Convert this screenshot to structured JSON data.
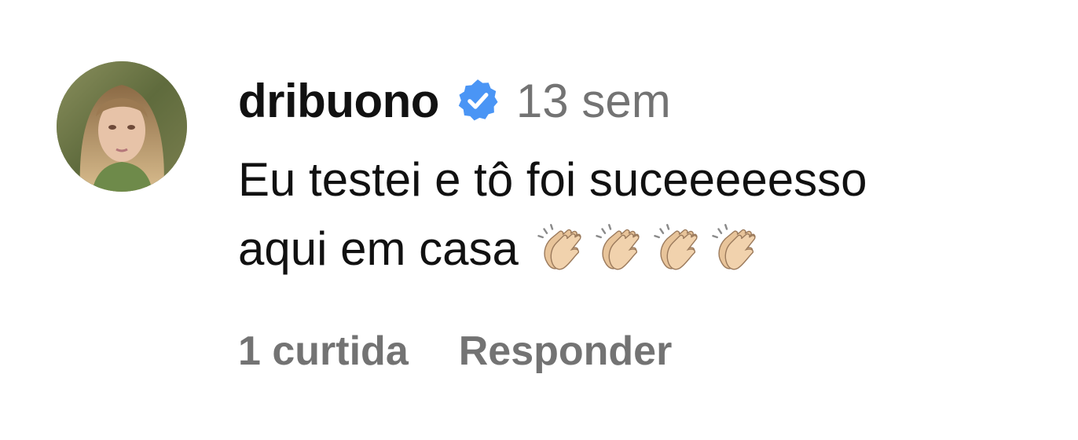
{
  "comment": {
    "username": "dribuono",
    "verified_icon": "verified-badge-icon",
    "timestamp": "13 sem",
    "text_line1": "Eu testei e tô foi suceeeeesso",
    "text_line2": "aqui em casa",
    "emoji": [
      "clapping-hands-icon",
      "clapping-hands-icon",
      "clapping-hands-icon",
      "clapping-hands-icon"
    ],
    "likes_label": "1 curtida",
    "reply_label": "Responder"
  },
  "colors": {
    "text": "#111111",
    "muted": "#737373",
    "verified": "#4a95f5",
    "background": "#ffffff"
  }
}
